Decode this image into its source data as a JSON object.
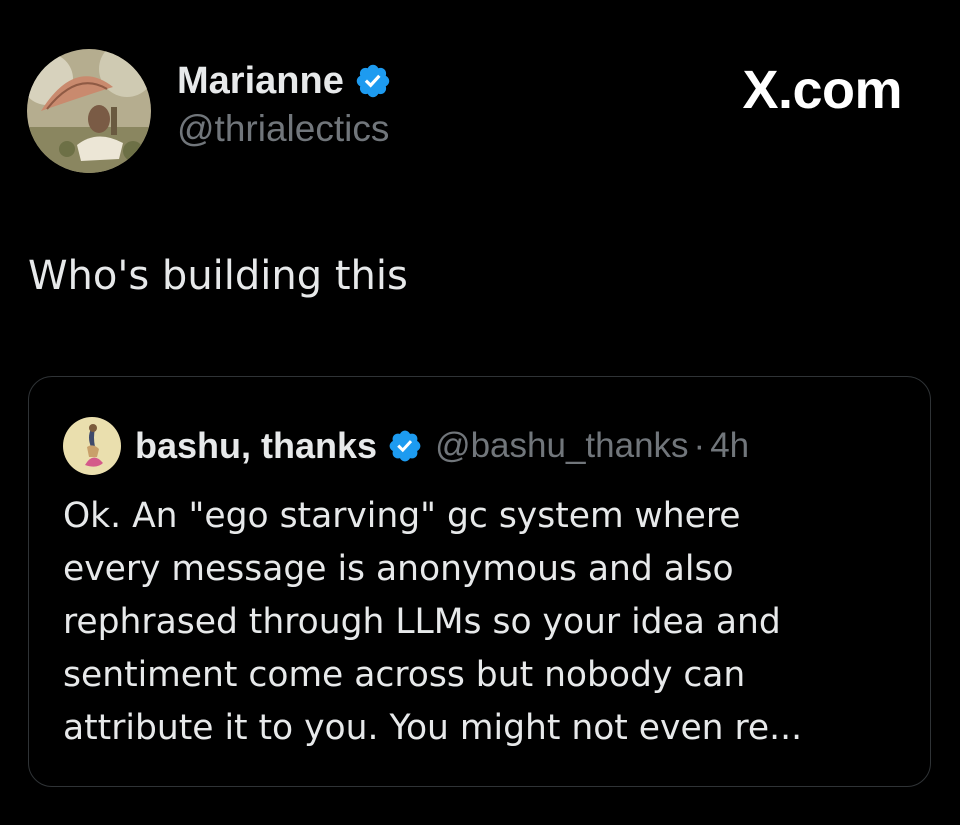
{
  "tweet": {
    "author": {
      "name": "Marianne",
      "handle": "@thrialectics",
      "verified": true
    },
    "brand": "X.com",
    "text": "Who's building this"
  },
  "quoted_tweet": {
    "author": {
      "name": "bashu, thanks",
      "handle": "@bashu_thanks",
      "verified": true
    },
    "separator": "·",
    "time": "4h",
    "text": "Ok. An \"ego starving\" gc system where\nevery message is anonymous and also\nrephrased through LLMs so your idea and\nsentiment come across but nobody can\nattribute it to you.  You might not even re..."
  },
  "colors": {
    "background": "#000000",
    "primary_text": "#e7e9ea",
    "secondary_text": "#71767b",
    "verified_blue": "#1d9bf0",
    "card_border": "#2f3336"
  },
  "icons": {
    "verified": "verified-badge-icon"
  }
}
